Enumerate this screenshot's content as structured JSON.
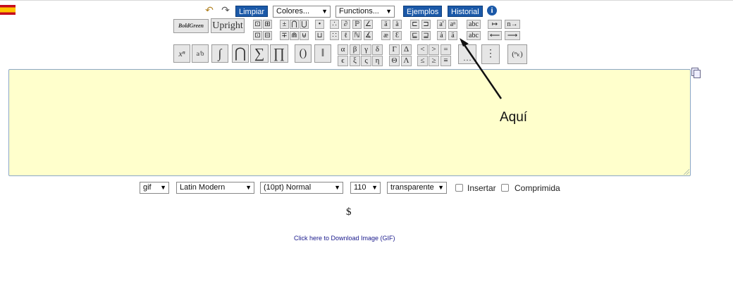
{
  "toolbar": {
    "language_flag": "spain-flag",
    "undo_icon": "undo-icon",
    "redo_icon": "redo-icon",
    "limpiar_label": "Limpiar",
    "colores_label": "Colores...",
    "functions_label": "Functions...",
    "ejemplos_label": "Ejemplos",
    "historial_label": "Historial",
    "info_label": "i"
  },
  "style_buttons": {
    "boldgreen_label": "BoldGreen",
    "upright_label": "Upright"
  },
  "large_buttons": [
    "xⁿ",
    "a/b",
    "∫",
    "⋂",
    "∑",
    "∏",
    "()",
    "‖"
  ],
  "symbol_grid_row1": [
    "⊡",
    "⊞",
    "±",
    "⋂",
    "⋃",
    "•",
    "∴",
    "∂",
    "ℙ",
    "∠",
    "ä",
    "à",
    "⊏",
    "⊐",
    "a'",
    "aⁿ",
    "abc",
    "↦",
    "n→"
  ],
  "symbol_grid_row2": [
    "⊡",
    "⊟",
    "∓",
    "⋒",
    "⊎",
    "⊔",
    "∷",
    "ℓ",
    "ℕ",
    "∡",
    "æ",
    "Ɛ",
    "⊑",
    "⊒",
    "ȧ",
    "ä",
    "abc",
    "⟵",
    "⟶"
  ],
  "greek_row1": [
    "α",
    "β",
    "γ",
    "δ",
    "Γ",
    "Δ",
    "<",
    ">",
    "="
  ],
  "greek_row2": [
    "ϵ",
    "ξ",
    "ς",
    "η",
    "Θ",
    "Λ",
    "≤",
    "≥",
    "≡"
  ],
  "matrix_buttons": [
    "…",
    "⋮",
    "(ⁿₖ)"
  ],
  "annotation": "Aquí",
  "output_options": {
    "format": "gif",
    "font": "Latin Modern",
    "size": "(10pt) Normal",
    "dpi": "110",
    "background": "transparente",
    "insertar_label": "Insertar",
    "comprimida_label": "Comprimida"
  },
  "preview_text": "$",
  "download_link": "Click here to Download Image (GIF)"
}
